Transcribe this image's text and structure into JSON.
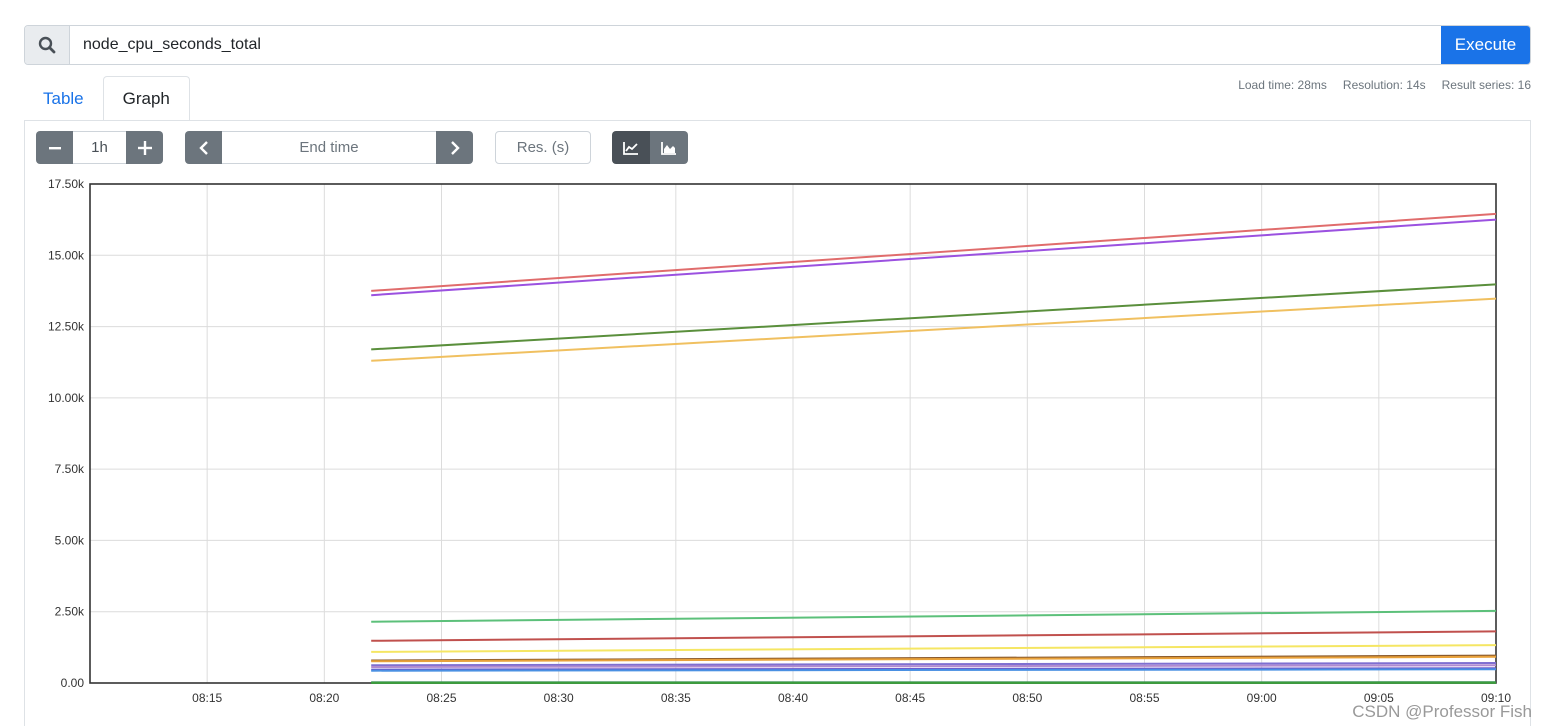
{
  "query": {
    "value": "node_cpu_seconds_total",
    "execute_label": "Execute",
    "search_icon": "search-icon"
  },
  "tabs": [
    {
      "label": "Table",
      "active": false
    },
    {
      "label": "Graph",
      "active": true
    }
  ],
  "stats": {
    "load_time": "Load time: 28ms",
    "resolution": "Resolution: 14s",
    "result_series": "Result series: 16"
  },
  "controls": {
    "range_value": "1h",
    "end_time_placeholder": "End time",
    "resolution_placeholder": "Res. (s)",
    "minus_icon": "minus-icon",
    "plus_icon": "plus-icon",
    "prev_icon": "chevron-left-icon",
    "next_icon": "chevron-right-icon",
    "lines_icon": "line-chart-icon",
    "stacked_icon": "area-chart-icon"
  },
  "chart_data": {
    "type": "line",
    "x_ticks": [
      "08:15",
      "08:20",
      "08:25",
      "08:30",
      "08:35",
      "08:40",
      "08:45",
      "08:50",
      "08:55",
      "09:00",
      "09:05",
      "09:10"
    ],
    "y_ticks": [
      "0.00",
      "2.50k",
      "5.00k",
      "7.50k",
      "10.00k",
      "12.50k",
      "15.00k",
      "17.50k"
    ],
    "xlim": [
      "08:10",
      "09:10"
    ],
    "ylim": [
      0,
      17500
    ],
    "grid": true,
    "series": [
      {
        "color": "#e06c6c",
        "x": [
          "08:22",
          "09:10"
        ],
        "values": [
          13750,
          16450
        ]
      },
      {
        "color": "#9b51e0",
        "x": [
          "08:22",
          "09:10"
        ],
        "values": [
          13600,
          16250
        ]
      },
      {
        "color": "#5a8f3c",
        "x": [
          "08:22",
          "09:10"
        ],
        "values": [
          11700,
          13980
        ]
      },
      {
        "color": "#f0c060",
        "x": [
          "08:22",
          "09:10"
        ],
        "values": [
          11300,
          13480
        ]
      },
      {
        "color": "#5cc07a",
        "x": [
          "08:22",
          "09:10"
        ],
        "values": [
          2150,
          2530
        ]
      },
      {
        "color": "#c0504d",
        "x": [
          "08:22",
          "09:10"
        ],
        "values": [
          1480,
          1810
        ]
      },
      {
        "color": "#f5e663",
        "x": [
          "08:22",
          "09:10"
        ],
        "values": [
          1090,
          1330
        ]
      },
      {
        "color": "#8b5a2b",
        "x": [
          "08:22",
          "09:10"
        ],
        "values": [
          790,
          960
        ]
      },
      {
        "color": "#e8a13a",
        "x": [
          "08:22",
          "09:10"
        ],
        "values": [
          760,
          920
        ]
      },
      {
        "color": "#7f6fd1",
        "x": [
          "08:22",
          "09:10"
        ],
        "values": [
          620,
          700
        ]
      },
      {
        "color": "#b08ad0",
        "x": [
          "08:22",
          "09:10"
        ],
        "values": [
          560,
          620
        ]
      },
      {
        "color": "#6a5acd",
        "x": [
          "08:22",
          "09:10"
        ],
        "values": [
          470,
          520
        ]
      },
      {
        "color": "#4a90e2",
        "x": [
          "08:22",
          "09:10"
        ],
        "values": [
          430,
          480
        ]
      },
      {
        "color": "#2e8b57",
        "x": [
          "08:22",
          "09:10"
        ],
        "values": [
          20,
          25
        ]
      },
      {
        "color": "#1e7e34",
        "x": [
          "08:22",
          "09:10"
        ],
        "values": [
          10,
          12
        ]
      },
      {
        "color": "#3c9d3c",
        "x": [
          "08:22",
          "09:10"
        ],
        "values": [
          5,
          6
        ]
      }
    ]
  },
  "watermark": "CSDN @Professor Fish"
}
